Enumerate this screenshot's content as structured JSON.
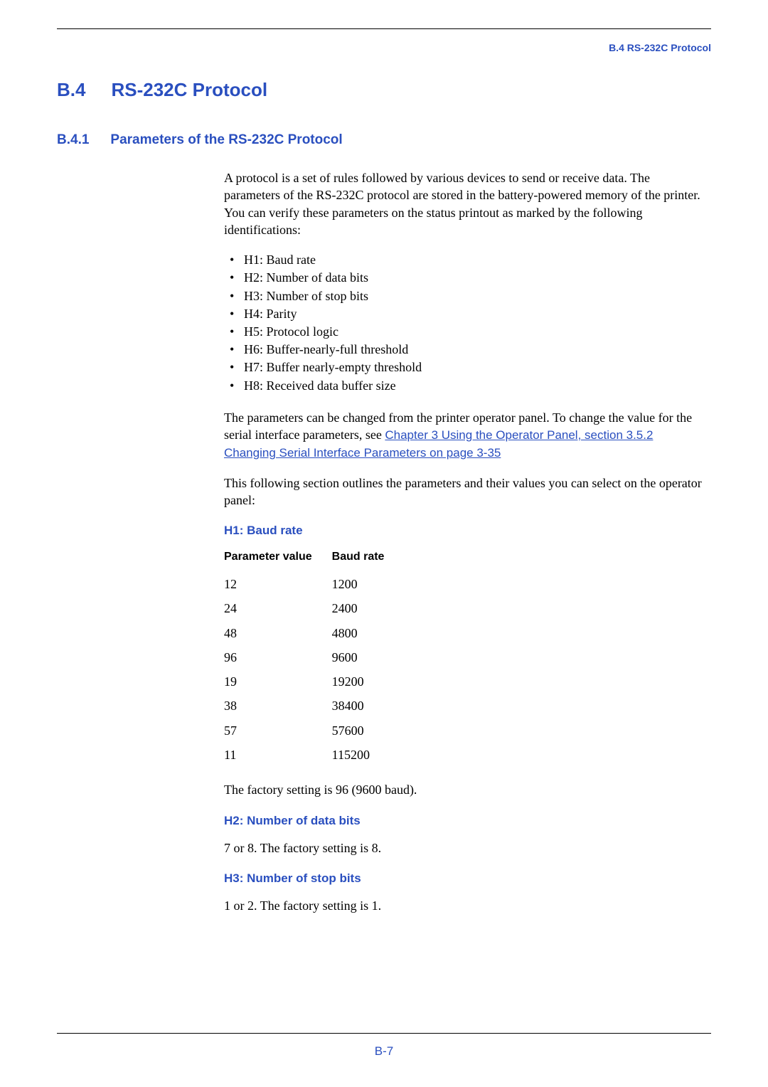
{
  "header": {
    "right": "B.4 RS-232C Protocol"
  },
  "section": {
    "num": "B.4",
    "title": "RS-232C Protocol"
  },
  "subsection": {
    "num": "B.4.1",
    "title": "Parameters of the RS-232C Protocol"
  },
  "intro": "A protocol is a set of rules followed by various devices to send or receive data. The parameters of the RS-232C protocol are stored in the battery-powered memory of the printer. You can verify these parameters on the status printout as marked by the following identifications:",
  "bullets": [
    "H1: Baud rate",
    "H2: Number of data bits",
    "H3: Number of stop bits",
    "H4: Parity",
    "H5: Protocol logic",
    "H6: Buffer-nearly-full threshold",
    "H7: Buffer nearly-empty threshold",
    "H8: Received data buffer size"
  ],
  "post_bullets_pre": "The parameters can be changed from the printer operator panel. To change the value for the serial interface parameters, see ",
  "link_text": "Chapter 3 Using the Operator Panel, section 3.5.2 Changing Serial Interface Parameters on page 3-35",
  "post_bullets_post": "This following section outlines the parameters and their values you can select on the operator panel:",
  "h1_title": "H1: Baud rate",
  "table": {
    "col1_header": "Parameter value",
    "col2_header": "Baud rate",
    "rows": [
      {
        "pv": "12",
        "br": "1200"
      },
      {
        "pv": "24",
        "br": "2400"
      },
      {
        "pv": "48",
        "br": "4800"
      },
      {
        "pv": "96",
        "br": "9600"
      },
      {
        "pv": "19",
        "br": "19200"
      },
      {
        "pv": "38",
        "br": "38400"
      },
      {
        "pv": "57",
        "br": "57600"
      },
      {
        "pv": "11",
        "br": "115200"
      }
    ]
  },
  "h1_note": "The factory setting is 96 (9600 baud).",
  "h2_title": "H2: Number of data bits",
  "h2_body": "7 or 8. The factory setting is 8.",
  "h3_title": "H3: Number of stop bits",
  "h3_body": "1 or 2. The factory setting is 1.",
  "pagenum": "B-7"
}
